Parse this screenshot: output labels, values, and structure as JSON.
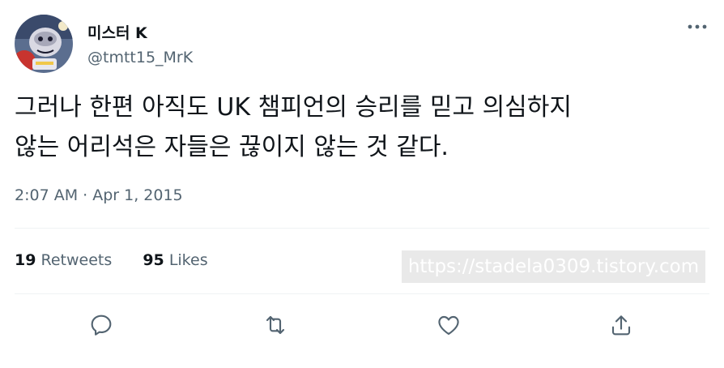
{
  "author": {
    "display_name": "미스터 K",
    "handle": "@tmtt15_MrK",
    "avatar_icon": "avatar-image"
  },
  "tweet": {
    "text": "그러나 한편 아직도 UK 챔피언의 승리를 믿고 의심하지\n않는 어리석은 자들은 끊이지 않는 것 같다.",
    "timestamp": "2:07 AM · Apr 1, 2015"
  },
  "stats": {
    "retweets_count": "19",
    "retweets_label": "Retweets",
    "likes_count": "95",
    "likes_label": "Likes"
  },
  "watermark": "https://stadela0309.tistory.com",
  "actions": {
    "reply_icon": "reply-icon",
    "retweet_icon": "retweet-icon",
    "like_icon": "heart-icon",
    "share_icon": "share-icon",
    "more_icon": "more-icon"
  },
  "colors": {
    "text": "#0f1419",
    "secondary": "#536471",
    "divider": "#eff3f4"
  }
}
